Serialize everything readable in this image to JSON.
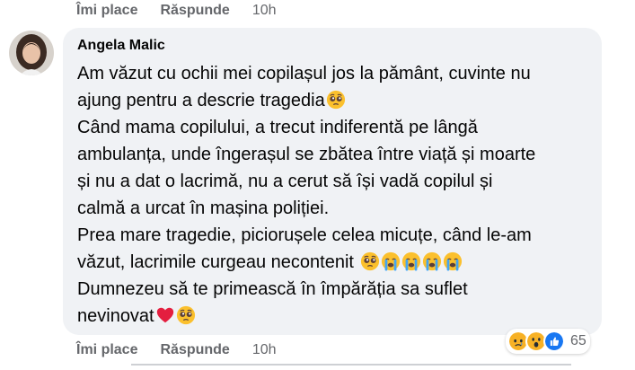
{
  "top_actions": {
    "like": "Îmi place",
    "reply": "Răspunde",
    "time": "10h"
  },
  "comment": {
    "author": "Angela Malic",
    "lines": [
      "Am văzut cu ochii mei copilașul jos la pământ, cuvinte nu",
      "ajung pentru a descrie tragedia",
      "Când mama copilului, a trecut indiferentă pe lângă",
      "ambulanța, unde îngerașul se zbătea între viață și moarte",
      "și nu a dat o lacrimă, nu a cerut să își vadă copilul și",
      "calmă a urcat în mașina poliției.",
      "Prea mare tragedie, piciorușele celea micuțe, când le-am",
      "văzut, lacrimile curgeau necontenit",
      "Dumnezeu să te primească în împărăția sa suflet",
      "nevinovat"
    ],
    "emoji_names": [
      "pleading-face",
      "crying-face",
      "heart",
      "loudly-crying-face"
    ]
  },
  "bottom_actions": {
    "like": "Îmi place",
    "reply": "Răspunde",
    "time": "10h"
  },
  "reactions": {
    "types": [
      "sad",
      "wow",
      "like"
    ],
    "count": "65"
  },
  "colors": {
    "bubble_bg": "#f0f2f5",
    "secondary_text": "#65676b",
    "like_blue": "#1877f2",
    "reaction_yellow": "#f7b125",
    "heart_red": "#e41e3f"
  }
}
